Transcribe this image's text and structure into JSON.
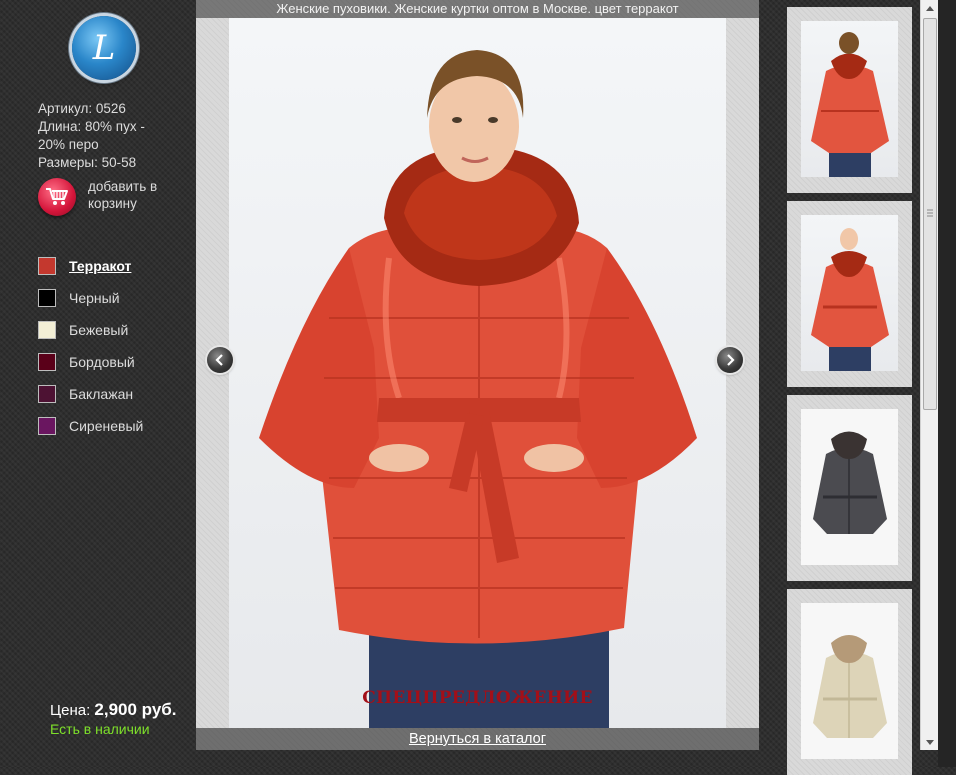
{
  "logo": {
    "letter": "L"
  },
  "product": {
    "article": "Артикул: 0526",
    "length": "Длина: 80% пух - 20% перо",
    "sizes": "Размеры: 50-58"
  },
  "cart": {
    "label": "добавить в корзину",
    "icon": "cart-icon"
  },
  "colors": [
    {
      "label": "Терракот",
      "color": "#c4382e",
      "active": true
    },
    {
      "label": "Черный",
      "color": "#000000",
      "active": false
    },
    {
      "label": "Бежевый",
      "color": "#f3efd6",
      "active": false
    },
    {
      "label": "Бордовый",
      "color": "#5a0019",
      "active": false
    },
    {
      "label": "Баклажан",
      "color": "#4d1233",
      "active": false
    },
    {
      "label": "Сиреневый",
      "color": "#6a1660",
      "active": false
    }
  ],
  "price": {
    "label": "Цена:",
    "value": "2,900 руб."
  },
  "stock": "Есть в наличии",
  "viewer": {
    "title": "Женские пуховики. Женские куртки оптом в Москве. цвет терракот",
    "special": "СПЕЦПРЕДЛОЖЕНИЕ",
    "back_link": "Вернуться в каталог",
    "prev_icon": "chevron-left-icon",
    "next_icon": "chevron-right-icon"
  },
  "thumbnails": [
    {
      "name": "thumb-terracotta-back",
      "color": "#e2553f"
    },
    {
      "name": "thumb-terracotta-front",
      "color": "#e2553f"
    },
    {
      "name": "thumb-gray",
      "color": "#4b4b50"
    },
    {
      "name": "thumb-beige",
      "color": "#ddd4b8"
    }
  ],
  "colors_theme": {
    "accent_red": "#a30f18",
    "stock_green": "#7ee02a"
  }
}
